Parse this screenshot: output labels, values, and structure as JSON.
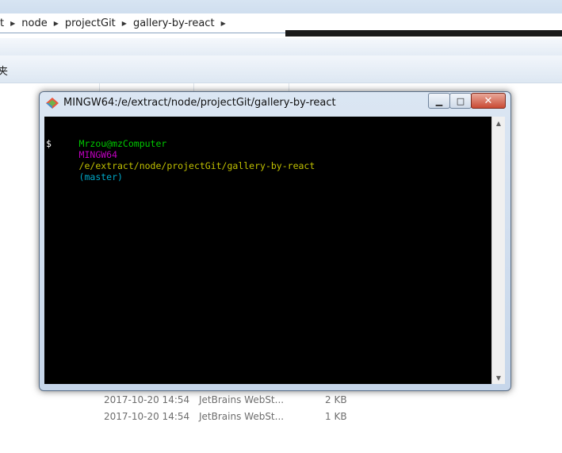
{
  "explorer": {
    "breadcrumb": [
      {
        "label": "t"
      },
      {
        "label": "node"
      },
      {
        "label": "projectGit"
      },
      {
        "label": "gallery-by-react"
      }
    ],
    "nav_label": "夹",
    "files": [
      {
        "modified": "2017-10-20 14:54",
        "type": "JetBrains WebSt...",
        "size": "2 KB"
      },
      {
        "modified": "2017-10-20 14:54",
        "type": "JetBrains WebSt...",
        "size": "1 KB"
      }
    ]
  },
  "terminal": {
    "title": "MINGW64:/e/extract/node/projectGit/gallery-by-react",
    "controls": {
      "minimize": "▁",
      "maximize": "□",
      "close": "✕"
    },
    "prompt": {
      "user_host": "Mrzou@mzComputer",
      "env": "MINGW64",
      "path": "/e/extract/node/projectGit/gallery-by-react",
      "branch": "(master)",
      "symbol": "$"
    },
    "colors": {
      "user_host": "#00c800",
      "env": "#c000c0",
      "path": "#c0c000",
      "branch": "#00a8c8",
      "text": "#ffffff",
      "background": "#000000"
    }
  }
}
